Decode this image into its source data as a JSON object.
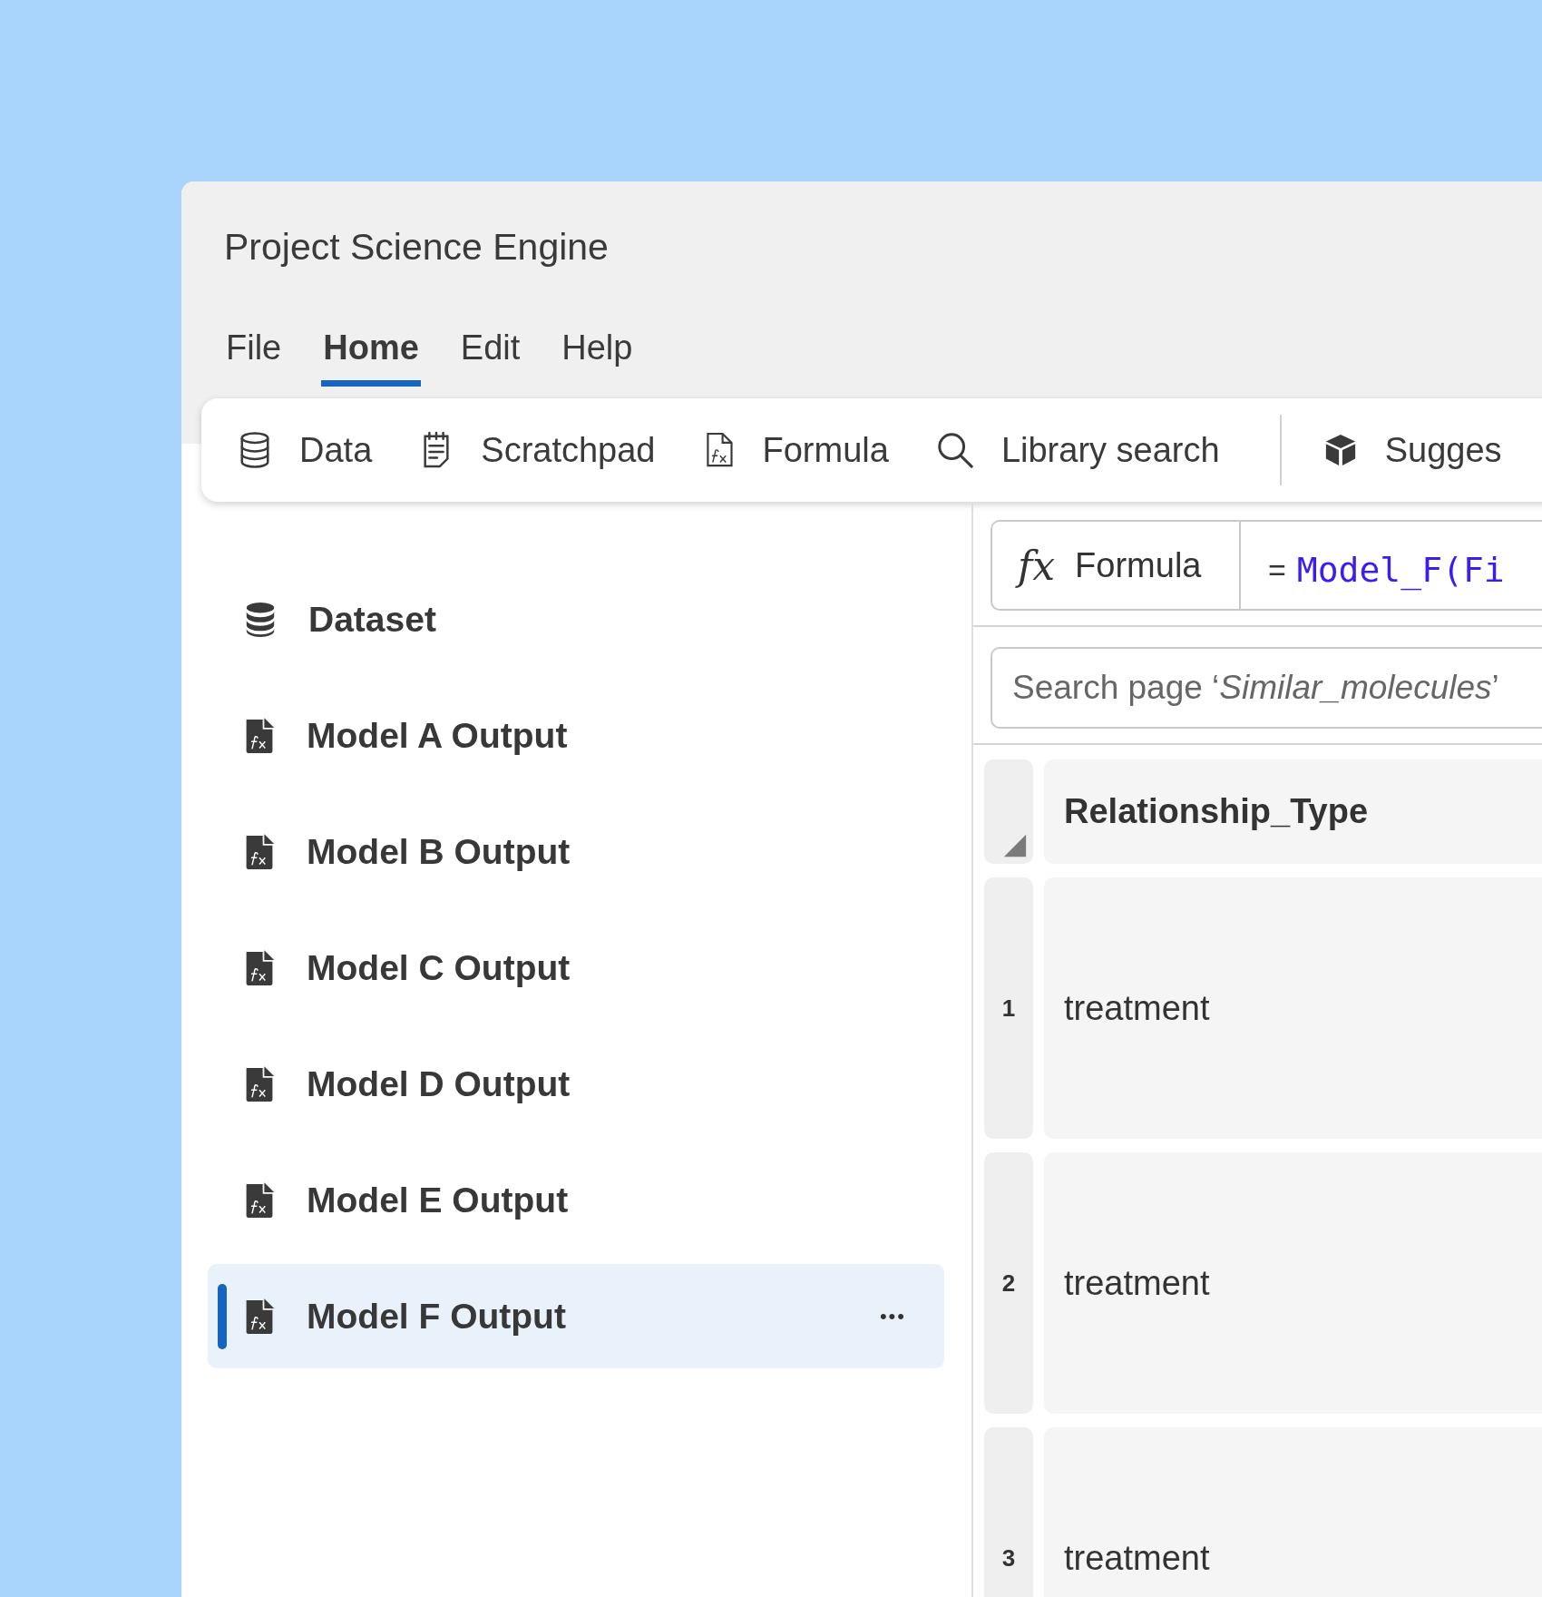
{
  "window": {
    "title": "Project Science Engine"
  },
  "menu": [
    {
      "label": "File",
      "selected": false
    },
    {
      "label": "Home",
      "selected": true
    },
    {
      "label": "Edit",
      "selected": false
    },
    {
      "label": "Help",
      "selected": false
    }
  ],
  "toolbar": [
    {
      "label": "Data",
      "kind": "database"
    },
    {
      "label": "Scratchpad",
      "kind": "notepad"
    },
    {
      "label": "Formula",
      "kind": "formula"
    },
    {
      "label": "Library search",
      "kind": "search"
    },
    {
      "label": "Sugges",
      "kind": "cube"
    }
  ],
  "sidebar": {
    "items": [
      {
        "label": "Dataset",
        "kind": "database",
        "selected": false
      },
      {
        "label": "Model A Output",
        "kind": "formula",
        "selected": false
      },
      {
        "label": "Model B Output",
        "kind": "formula",
        "selected": false
      },
      {
        "label": "Model C Output",
        "kind": "formula",
        "selected": false
      },
      {
        "label": "Model D Output",
        "kind": "formula",
        "selected": false
      },
      {
        "label": "Model E Output",
        "kind": "formula",
        "selected": false
      },
      {
        "label": "Model F Output",
        "kind": "formula",
        "selected": true,
        "more": "•••"
      }
    ]
  },
  "formula_bar": {
    "icon": "fx",
    "label": "Formula",
    "equals": "=",
    "expression": "Model_F(Fi"
  },
  "search": {
    "placeholder": "Search page ‘*Similar_molecules*’"
  },
  "table": {
    "columns": [
      "Relationship_Type"
    ],
    "rows": [
      {
        "number": "1",
        "cells": [
          "treatment"
        ]
      },
      {
        "number": "2",
        "cells": [
          "treatment"
        ]
      },
      {
        "number": "3",
        "cells": [
          "treatment"
        ]
      }
    ]
  }
}
